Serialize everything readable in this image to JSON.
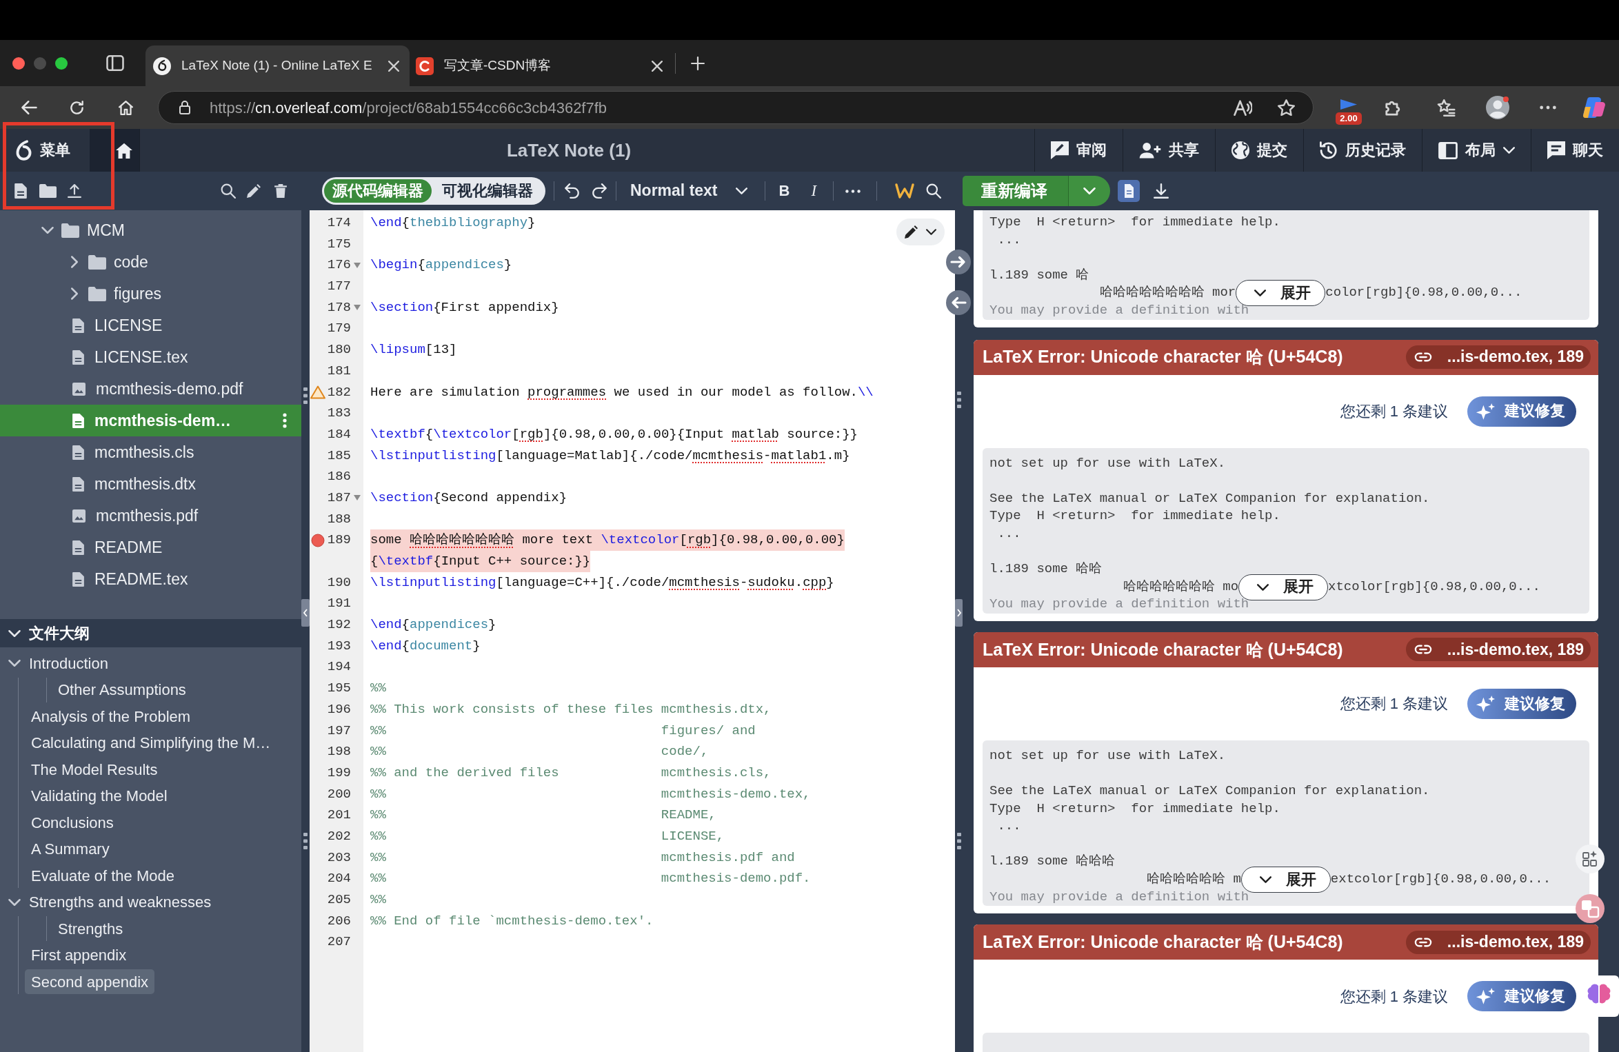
{
  "browser": {
    "tabs": [
      {
        "title": "LaTeX Note (1) - Online LaTeX E",
        "kind": "editor",
        "selected": true
      },
      {
        "title": "写文章-CSDN博客",
        "kind": "blog",
        "selected": false
      }
    ],
    "address": {
      "scheme": "https://",
      "host": "cn.overleaf.com",
      "path": "/project/68ab1554cc66c3cb4362f7fb"
    },
    "extension_badge": "2.00"
  },
  "toolbar": {
    "menu": "菜单",
    "title": "LaTeX Note (1)",
    "actions": [
      {
        "label": "审阅",
        "kind": "review"
      },
      {
        "label": "共享",
        "kind": "share"
      },
      {
        "label": "提交",
        "kind": "submit"
      },
      {
        "label": "历史记录",
        "kind": "history"
      },
      {
        "label": "布局",
        "kind": "layout"
      },
      {
        "label": "聊天",
        "kind": "chat"
      }
    ]
  },
  "editor_toolbar": {
    "modes": [
      {
        "label": "源代码编辑器",
        "selected": true
      },
      {
        "label": "可视化编辑器",
        "selected": false
      }
    ],
    "text_style": "Normal text",
    "bold": "B",
    "italic": "I",
    "recompile": "重新编译"
  },
  "file_tree": [
    {
      "name": "MCM",
      "kind": "folder",
      "expanded": true,
      "selected": false,
      "children": [
        {
          "name": "code",
          "kind": "folder",
          "expanded": false,
          "selected": false
        },
        {
          "name": "figures",
          "kind": "folder",
          "expanded": false,
          "selected": false
        },
        {
          "name": "LICENSE",
          "kind": "text",
          "selected": false
        },
        {
          "name": "LICENSE.tex",
          "kind": "text",
          "selected": false
        },
        {
          "name": "mcmthesis-demo.pdf",
          "kind": "image",
          "selected": false
        },
        {
          "name": "mcmthesis-dem…",
          "kind": "text",
          "selected": true
        },
        {
          "name": "mcmthesis.cls",
          "kind": "text",
          "selected": false
        },
        {
          "name": "mcmthesis.dtx",
          "kind": "text",
          "selected": false
        },
        {
          "name": "mcmthesis.pdf",
          "kind": "image",
          "selected": false
        },
        {
          "name": "README",
          "kind": "text",
          "selected": false
        },
        {
          "name": "README.tex",
          "kind": "text",
          "selected": false
        }
      ]
    }
  ],
  "outline": {
    "title": "文件大纲",
    "expanded": true,
    "items": [
      {
        "title": "Introduction",
        "expanded": true,
        "selected": false,
        "children": [
          {
            "children": [
              {
                "title": "Other Assumptions",
                "selected": false
              }
            ]
          },
          {
            "title": "Analysis of the Problem",
            "selected": false
          },
          {
            "title": "Calculating and Simplifying the M…",
            "selected": false
          },
          {
            "title": "The Model Results",
            "selected": false
          },
          {
            "title": "Validating the Model",
            "selected": false
          },
          {
            "title": "Conclusions",
            "selected": false
          },
          {
            "title": "A Summary",
            "selected": false
          },
          {
            "title": "Evaluate of the Mode",
            "selected": false
          }
        ]
      },
      {
        "title": "Strengths and weaknesses",
        "expanded": true,
        "selected": false,
        "children": [
          {
            "children": [
              {
                "title": "Strengths",
                "selected": false
              }
            ]
          },
          {
            "title": "First appendix",
            "selected": false
          },
          {
            "title": "Second appendix",
            "selected": true
          }
        ]
      }
    ]
  },
  "editor": {
    "lines": [
      {
        "number": "174",
        "tokens": [
          {
            "text": "\\end",
            "kind": "command"
          },
          {
            "text": "{"
          },
          {
            "text": "thebibliography",
            "kind": "argument"
          },
          {
            "text": "}"
          }
        ]
      },
      {
        "number": "175"
      },
      {
        "number": "176",
        "foldable": true,
        "tokens": [
          {
            "text": "\\begin",
            "kind": "command"
          },
          {
            "text": "{"
          },
          {
            "text": "appendices",
            "kind": "argument"
          },
          {
            "text": "}"
          }
        ]
      },
      {
        "number": "177"
      },
      {
        "number": "178",
        "foldable": true,
        "tokens": [
          {
            "text": "\\section",
            "kind": "command"
          },
          {
            "text": "{First appendix}"
          }
        ]
      },
      {
        "number": "179"
      },
      {
        "number": "180",
        "tokens": [
          {
            "text": "\\lipsum",
            "kind": "command"
          },
          {
            "text": "[13]"
          }
        ]
      },
      {
        "number": "181"
      },
      {
        "number": "182",
        "warning": true,
        "tokens": [
          {
            "text": "Here are simulation "
          },
          {
            "text": "programmes",
            "kind": "typo"
          },
          {
            "text": " we used in our model as follow."
          },
          {
            "text": "\\\\",
            "kind": "command"
          }
        ]
      },
      {
        "number": "183"
      },
      {
        "number": "184",
        "tokens": [
          {
            "text": "\\textbf",
            "kind": "command"
          },
          {
            "text": "{"
          },
          {
            "text": "\\textcolor",
            "kind": "command"
          },
          {
            "text": "["
          },
          {
            "text": "rgb",
            "kind": "typo"
          },
          {
            "text": "]{0.98,0.00,0.00}{Input "
          },
          {
            "text": "matlab",
            "kind": "typo"
          },
          {
            "text": " source:}}"
          }
        ]
      },
      {
        "number": "185",
        "tokens": [
          {
            "text": "\\lstinputlisting",
            "kind": "command"
          },
          {
            "text": "[language=Matlab]{./code/"
          },
          {
            "text": "mcmthesis",
            "kind": "typo"
          },
          {
            "text": "-"
          },
          {
            "text": "matlab1",
            "kind": "typo"
          },
          {
            "text": ".m}"
          }
        ]
      },
      {
        "number": "186"
      },
      {
        "number": "187",
        "foldable": true,
        "tokens": [
          {
            "text": "\\section",
            "kind": "command"
          },
          {
            "text": "{Second appendix}"
          }
        ]
      },
      {
        "number": "188"
      },
      {
        "number": "189",
        "error": true,
        "tokens": [
          {
            "text": "some "
          },
          {
            "text": "哈哈哈哈哈哈哈哈",
            "kind": "typo"
          },
          {
            "text": " more text "
          },
          {
            "text": "\\textcolor",
            "kind": "command"
          },
          {
            "text": "["
          },
          {
            "text": "rgb",
            "kind": "typo"
          },
          {
            "text": "]{0.98,0.00,0.00}"
          }
        ],
        "wrapped": [
          {
            "text": "{"
          },
          {
            "text": "\\textbf",
            "kind": "command"
          },
          {
            "text": "{Input C++ source:}}"
          }
        ]
      },
      {
        "number": "190",
        "tokens": [
          {
            "text": "\\lstinputlisting",
            "kind": "command"
          },
          {
            "text": "[language=C++]{./code/"
          },
          {
            "text": "mcmthesis",
            "kind": "typo"
          },
          {
            "text": "-"
          },
          {
            "text": "sudoku",
            "kind": "typo"
          },
          {
            "text": "."
          },
          {
            "text": "cpp",
            "kind": "typo"
          },
          {
            "text": "}"
          }
        ]
      },
      {
        "number": "191"
      },
      {
        "number": "192",
        "tokens": [
          {
            "text": "\\end",
            "kind": "command"
          },
          {
            "text": "{"
          },
          {
            "text": "appendices",
            "kind": "argument"
          },
          {
            "text": "}"
          }
        ]
      },
      {
        "number": "193",
        "tokens": [
          {
            "text": "\\end",
            "kind": "command"
          },
          {
            "text": "{"
          },
          {
            "text": "document",
            "kind": "argument"
          },
          {
            "text": "}"
          }
        ]
      },
      {
        "number": "194"
      },
      {
        "number": "195",
        "tokens": [
          {
            "text": "%%",
            "kind": "comment"
          }
        ]
      },
      {
        "number": "196",
        "tokens": [
          {
            "text": "%% This work consists of these files mcmthesis.dtx,",
            "kind": "comment"
          }
        ]
      },
      {
        "number": "197",
        "tokens": [
          {
            "text": "%%                                   figures/ and",
            "kind": "comment"
          }
        ]
      },
      {
        "number": "198",
        "tokens": [
          {
            "text": "%%                                   code/,",
            "kind": "comment"
          }
        ]
      },
      {
        "number": "199",
        "tokens": [
          {
            "text": "%% and the derived files             mcmthesis.cls,",
            "kind": "comment"
          }
        ]
      },
      {
        "number": "200",
        "tokens": [
          {
            "text": "%%                                   mcmthesis-demo.tex,",
            "kind": "comment"
          }
        ]
      },
      {
        "number": "201",
        "tokens": [
          {
            "text": "%%                                   README,",
            "kind": "comment"
          }
        ]
      },
      {
        "number": "202",
        "tokens": [
          {
            "text": "%%                                   LICENSE,",
            "kind": "comment"
          }
        ]
      },
      {
        "number": "203",
        "tokens": [
          {
            "text": "%%                                   mcmthesis.pdf and",
            "kind": "comment"
          }
        ]
      },
      {
        "number": "204",
        "tokens": [
          {
            "text": "%%                                   mcmthesis-demo.pdf.",
            "kind": "comment"
          }
        ]
      },
      {
        "number": "205",
        "tokens": [
          {
            "text": "%%",
            "kind": "comment"
          }
        ]
      },
      {
        "number": "206",
        "tokens": [
          {
            "text": "%% End of file `mcmthesis-demo.tex'.",
            "kind": "comment"
          }
        ]
      },
      {
        "number": "207"
      }
    ]
  },
  "logs": [
    {
      "blocks": [
        [
          "Type  H <return>  for immediate help.",
          " ..."
        ],
        [
          "l.189 some 哈"
        ]
      ],
      "continued": {
        "before": "哈哈哈哈哈哈哈哈 mor",
        "after": "color[rgb]{0.98,0.00,0..."
      },
      "expand": "展开",
      "faded": "You may provide a definition with"
    },
    {
      "title": "LaTeX Error: Unicode character 哈 (U+54C8)",
      "location": "...is-demo.tex, 189",
      "suggestions": "您还剩 1 条建议",
      "fix": "建议修复",
      "blocks": [
        [
          "not set up for use with LaTeX."
        ],
        [
          "See the LaTeX manual or LaTeX Companion for explanation.",
          "Type  H <return>  for immediate help.",
          " ..."
        ],
        [
          "l.189 some 哈哈"
        ]
      ],
      "continued": {
        "before": "哈哈哈哈哈哈哈 mo",
        "after": "xtcolor[rgb]{0.98,0.00,0..."
      },
      "expand": "展开",
      "faded": "You may provide a definition with"
    },
    {
      "title": "LaTeX Error: Unicode character 哈 (U+54C8)",
      "location": "...is-demo.tex, 189",
      "suggestions": "您还剩 1 条建议",
      "fix": "建议修复",
      "blocks": [
        [
          "not set up for use with LaTeX."
        ],
        [
          "See the LaTeX manual or LaTeX Companion for explanation.",
          "Type  H <return>  for immediate help.",
          " ..."
        ],
        [
          "l.189 some 哈哈哈"
        ]
      ],
      "continued": {
        "before": "哈哈哈哈哈哈 m",
        "after": "extcolor[rgb]{0.98,0.00,0..."
      },
      "expand": "展开",
      "faded": "You may provide a definition with"
    },
    {
      "title": "LaTeX Error: Unicode character 哈 (U+54C8)",
      "location": "...is-demo.tex, 189",
      "suggestions": "您还剩 1 条建议",
      "fix": "建议修复"
    }
  ]
}
